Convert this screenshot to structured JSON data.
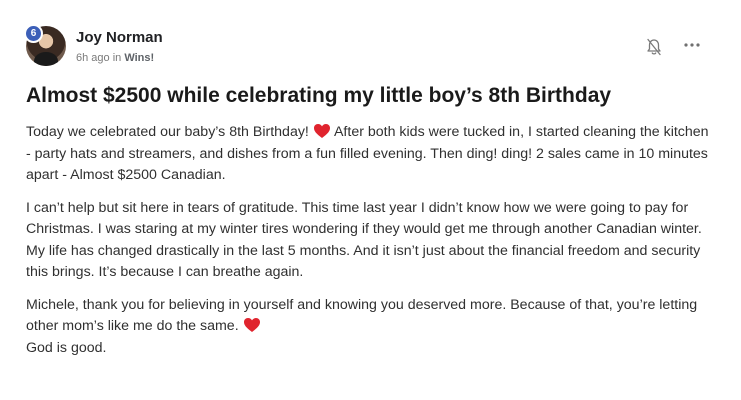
{
  "post": {
    "author": {
      "name": "Joy Norman",
      "level": "6"
    },
    "meta": {
      "time": "6h ago in ",
      "category": "Wins!"
    },
    "title": "Almost $2500 while celebrating my little boy’s 8th Birthday",
    "body": {
      "p1_a": "Today we celebrated our baby’s 8th Birthday! ",
      "p1_b": " After both kids were tucked in, I started cleaning the kitchen - party hats and streamers, and dishes from a fun filled evening. Then ding! ding! 2 sales came in 10 minutes apart - Almost $2500 Canadian.",
      "p2": "I can’t help but sit here in tears of gratitude. This time last year I didn’t know how we were going to pay for Christmas. I was staring at my winter tires wondering if they would get me through another Canadian winter. My life has changed drastically in the last 5 months. And it isn’t just about the financial freedom and security this brings. It’s because I can breathe again.",
      "p3_a": "Michele, thank you for believing in yourself and knowing you deserved more. Because of that, you’re letting other mom’s like me do the same. ",
      "p3_b": "God is good."
    },
    "icons": {
      "bell": "bell-off-icon",
      "more": "more-horizontal-icon",
      "heart": "red-heart-emoji"
    },
    "colors": {
      "level_badge": "#3c5fb8",
      "heart": "#e0242e"
    }
  }
}
